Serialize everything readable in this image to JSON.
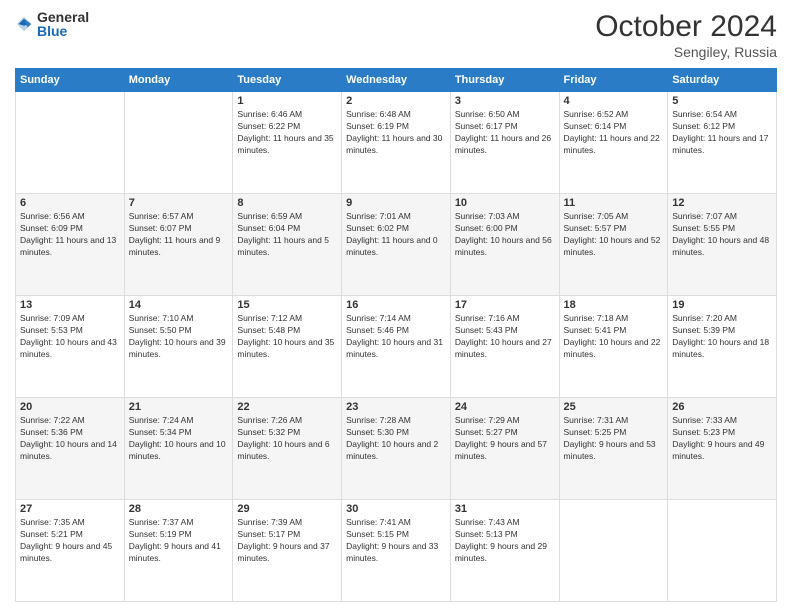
{
  "header": {
    "logo_general": "General",
    "logo_blue": "Blue",
    "month_year": "October 2024",
    "location": "Sengiley, Russia"
  },
  "days_of_week": [
    "Sunday",
    "Monday",
    "Tuesday",
    "Wednesday",
    "Thursday",
    "Friday",
    "Saturday"
  ],
  "weeks": [
    [
      {
        "day": "",
        "sunrise": "",
        "sunset": "",
        "daylight": ""
      },
      {
        "day": "",
        "sunrise": "",
        "sunset": "",
        "daylight": ""
      },
      {
        "day": "1",
        "sunrise": "Sunrise: 6:46 AM",
        "sunset": "Sunset: 6:22 PM",
        "daylight": "Daylight: 11 hours and 35 minutes."
      },
      {
        "day": "2",
        "sunrise": "Sunrise: 6:48 AM",
        "sunset": "Sunset: 6:19 PM",
        "daylight": "Daylight: 11 hours and 30 minutes."
      },
      {
        "day": "3",
        "sunrise": "Sunrise: 6:50 AM",
        "sunset": "Sunset: 6:17 PM",
        "daylight": "Daylight: 11 hours and 26 minutes."
      },
      {
        "day": "4",
        "sunrise": "Sunrise: 6:52 AM",
        "sunset": "Sunset: 6:14 PM",
        "daylight": "Daylight: 11 hours and 22 minutes."
      },
      {
        "day": "5",
        "sunrise": "Sunrise: 6:54 AM",
        "sunset": "Sunset: 6:12 PM",
        "daylight": "Daylight: 11 hours and 17 minutes."
      }
    ],
    [
      {
        "day": "6",
        "sunrise": "Sunrise: 6:56 AM",
        "sunset": "Sunset: 6:09 PM",
        "daylight": "Daylight: 11 hours and 13 minutes."
      },
      {
        "day": "7",
        "sunrise": "Sunrise: 6:57 AM",
        "sunset": "Sunset: 6:07 PM",
        "daylight": "Daylight: 11 hours and 9 minutes."
      },
      {
        "day": "8",
        "sunrise": "Sunrise: 6:59 AM",
        "sunset": "Sunset: 6:04 PM",
        "daylight": "Daylight: 11 hours and 5 minutes."
      },
      {
        "day": "9",
        "sunrise": "Sunrise: 7:01 AM",
        "sunset": "Sunset: 6:02 PM",
        "daylight": "Daylight: 11 hours and 0 minutes."
      },
      {
        "day": "10",
        "sunrise": "Sunrise: 7:03 AM",
        "sunset": "Sunset: 6:00 PM",
        "daylight": "Daylight: 10 hours and 56 minutes."
      },
      {
        "day": "11",
        "sunrise": "Sunrise: 7:05 AM",
        "sunset": "Sunset: 5:57 PM",
        "daylight": "Daylight: 10 hours and 52 minutes."
      },
      {
        "day": "12",
        "sunrise": "Sunrise: 7:07 AM",
        "sunset": "Sunset: 5:55 PM",
        "daylight": "Daylight: 10 hours and 48 minutes."
      }
    ],
    [
      {
        "day": "13",
        "sunrise": "Sunrise: 7:09 AM",
        "sunset": "Sunset: 5:53 PM",
        "daylight": "Daylight: 10 hours and 43 minutes."
      },
      {
        "day": "14",
        "sunrise": "Sunrise: 7:10 AM",
        "sunset": "Sunset: 5:50 PM",
        "daylight": "Daylight: 10 hours and 39 minutes."
      },
      {
        "day": "15",
        "sunrise": "Sunrise: 7:12 AM",
        "sunset": "Sunset: 5:48 PM",
        "daylight": "Daylight: 10 hours and 35 minutes."
      },
      {
        "day": "16",
        "sunrise": "Sunrise: 7:14 AM",
        "sunset": "Sunset: 5:46 PM",
        "daylight": "Daylight: 10 hours and 31 minutes."
      },
      {
        "day": "17",
        "sunrise": "Sunrise: 7:16 AM",
        "sunset": "Sunset: 5:43 PM",
        "daylight": "Daylight: 10 hours and 27 minutes."
      },
      {
        "day": "18",
        "sunrise": "Sunrise: 7:18 AM",
        "sunset": "Sunset: 5:41 PM",
        "daylight": "Daylight: 10 hours and 22 minutes."
      },
      {
        "day": "19",
        "sunrise": "Sunrise: 7:20 AM",
        "sunset": "Sunset: 5:39 PM",
        "daylight": "Daylight: 10 hours and 18 minutes."
      }
    ],
    [
      {
        "day": "20",
        "sunrise": "Sunrise: 7:22 AM",
        "sunset": "Sunset: 5:36 PM",
        "daylight": "Daylight: 10 hours and 14 minutes."
      },
      {
        "day": "21",
        "sunrise": "Sunrise: 7:24 AM",
        "sunset": "Sunset: 5:34 PM",
        "daylight": "Daylight: 10 hours and 10 minutes."
      },
      {
        "day": "22",
        "sunrise": "Sunrise: 7:26 AM",
        "sunset": "Sunset: 5:32 PM",
        "daylight": "Daylight: 10 hours and 6 minutes."
      },
      {
        "day": "23",
        "sunrise": "Sunrise: 7:28 AM",
        "sunset": "Sunset: 5:30 PM",
        "daylight": "Daylight: 10 hours and 2 minutes."
      },
      {
        "day": "24",
        "sunrise": "Sunrise: 7:29 AM",
        "sunset": "Sunset: 5:27 PM",
        "daylight": "Daylight: 9 hours and 57 minutes."
      },
      {
        "day": "25",
        "sunrise": "Sunrise: 7:31 AM",
        "sunset": "Sunset: 5:25 PM",
        "daylight": "Daylight: 9 hours and 53 minutes."
      },
      {
        "day": "26",
        "sunrise": "Sunrise: 7:33 AM",
        "sunset": "Sunset: 5:23 PM",
        "daylight": "Daylight: 9 hours and 49 minutes."
      }
    ],
    [
      {
        "day": "27",
        "sunrise": "Sunrise: 7:35 AM",
        "sunset": "Sunset: 5:21 PM",
        "daylight": "Daylight: 9 hours and 45 minutes."
      },
      {
        "day": "28",
        "sunrise": "Sunrise: 7:37 AM",
        "sunset": "Sunset: 5:19 PM",
        "daylight": "Daylight: 9 hours and 41 minutes."
      },
      {
        "day": "29",
        "sunrise": "Sunrise: 7:39 AM",
        "sunset": "Sunset: 5:17 PM",
        "daylight": "Daylight: 9 hours and 37 minutes."
      },
      {
        "day": "30",
        "sunrise": "Sunrise: 7:41 AM",
        "sunset": "Sunset: 5:15 PM",
        "daylight": "Daylight: 9 hours and 33 minutes."
      },
      {
        "day": "31",
        "sunrise": "Sunrise: 7:43 AM",
        "sunset": "Sunset: 5:13 PM",
        "daylight": "Daylight: 9 hours and 29 minutes."
      },
      {
        "day": "",
        "sunrise": "",
        "sunset": "",
        "daylight": ""
      },
      {
        "day": "",
        "sunrise": "",
        "sunset": "",
        "daylight": ""
      }
    ]
  ]
}
